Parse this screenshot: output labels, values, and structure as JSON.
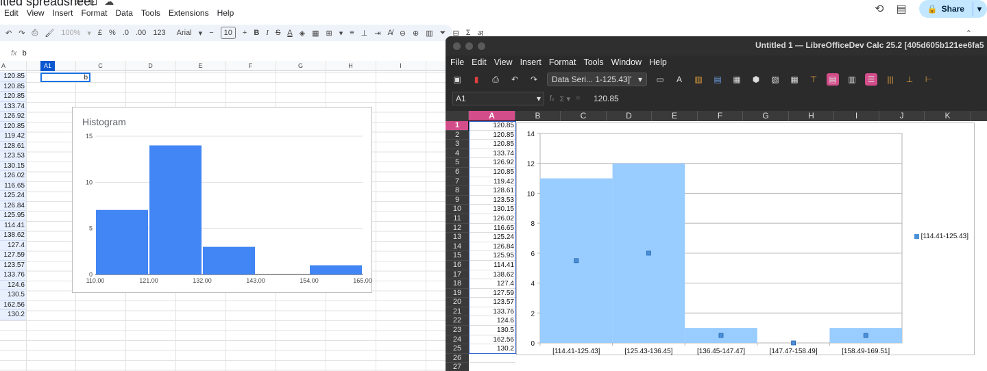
{
  "gsheets": {
    "title": "itled spreadsheet",
    "menu": [
      "Edit",
      "View",
      "Insert",
      "Format",
      "Data",
      "Tools",
      "Extensions",
      "Help"
    ],
    "share_label": "Share",
    "toolbar": {
      "zoom": "100%",
      "currency": "£",
      "percent": "%",
      "dec_less": ".0",
      "dec_more": ".00",
      "fmt123": "123",
      "font": "Arial",
      "font_size": "10"
    },
    "name_box": "A1",
    "formula_value": "b",
    "columns": [
      "A",
      "A1",
      "C",
      "D",
      "E",
      "F",
      "G",
      "H",
      "I"
    ],
    "col_a_values": [
      "120.85",
      "120.85",
      "120.85",
      "133.74",
      "126.92",
      "120.85",
      "119.42",
      "128.61",
      "123.53",
      "130.15",
      "126.02",
      "116.65",
      "125.24",
      "126.84",
      "125.95",
      "114.41",
      "138.62",
      "127.4",
      "127.59",
      "123.57",
      "133.76",
      "124.6",
      "130.5",
      "162.56",
      "130.2"
    ],
    "cell_b1": "b",
    "chart": {
      "title": "Histogram",
      "y_ticks": [
        "15",
        "10",
        "5",
        "0"
      ],
      "x_ticks": [
        "110.00",
        "121.00",
        "132.00",
        "143.00",
        "154.00",
        "165.00"
      ]
    }
  },
  "libreoffice": {
    "title": "Untitled 1 — LibreOfficeDev Calc 25.2 [405d605b121ee6fa5",
    "menu": [
      "File",
      "Edit",
      "View",
      "Insert",
      "Format",
      "Tools",
      "Window",
      "Help"
    ],
    "data_series_combo": "Data Seri... 1-125.43]'",
    "name_box": "A1",
    "formula_value": "120.85",
    "columns": [
      "A",
      "B",
      "C",
      "D",
      "E",
      "F",
      "G",
      "H",
      "I",
      "J",
      "K"
    ],
    "rows": [
      {
        "n": "1",
        "v": "120.85"
      },
      {
        "n": "2",
        "v": "120.85"
      },
      {
        "n": "3",
        "v": "120.85"
      },
      {
        "n": "4",
        "v": "133.74"
      },
      {
        "n": "5",
        "v": "126.92"
      },
      {
        "n": "6",
        "v": "120.85"
      },
      {
        "n": "7",
        "v": "119.42"
      },
      {
        "n": "8",
        "v": "128.61"
      },
      {
        "n": "9",
        "v": "123.53"
      },
      {
        "n": "10",
        "v": "130.15"
      },
      {
        "n": "11",
        "v": "126.02"
      },
      {
        "n": "12",
        "v": "116.65"
      },
      {
        "n": "13",
        "v": "125.24"
      },
      {
        "n": "14",
        "v": "126.84"
      },
      {
        "n": "15",
        "v": "125.95"
      },
      {
        "n": "16",
        "v": "114.41"
      },
      {
        "n": "17",
        "v": "138.62"
      },
      {
        "n": "18",
        "v": "127.4"
      },
      {
        "n": "19",
        "v": "127.59"
      },
      {
        "n": "20",
        "v": "123.57"
      },
      {
        "n": "21",
        "v": "133.76"
      },
      {
        "n": "22",
        "v": "124.6"
      },
      {
        "n": "23",
        "v": "130.5"
      },
      {
        "n": "24",
        "v": "162.56"
      },
      {
        "n": "25",
        "v": "130.2"
      },
      {
        "n": "26",
        "v": ""
      },
      {
        "n": "27",
        "v": ""
      }
    ],
    "legend": "[114.41-125.43]"
  },
  "chart_data": [
    {
      "type": "bar",
      "title": "Histogram",
      "bins": [
        [
          110,
          121
        ],
        [
          121,
          132
        ],
        [
          132,
          143
        ],
        [
          143,
          154
        ],
        [
          154,
          165
        ]
      ],
      "values": [
        7,
        14,
        3,
        0,
        1
      ],
      "x_ticks": [
        110,
        121,
        132,
        143,
        154,
        165
      ],
      "ylim": [
        0,
        15
      ],
      "y_ticks": [
        0,
        5,
        10,
        15
      ],
      "color": "#4285f4",
      "grid": true
    },
    {
      "type": "bar",
      "categories": [
        "[114.41-125.43]",
        "[125.43-136.45]",
        "[136.45-147.47]",
        "[147.47-158.49]",
        "[158.49-169.51]"
      ],
      "series": [
        {
          "name": "[114.41-125.43]",
          "values": [
            11,
            12,
            1,
            0,
            1
          ]
        }
      ],
      "ylim": [
        0,
        14
      ],
      "y_ticks": [
        0,
        2,
        4,
        6,
        8,
        10,
        12,
        14
      ],
      "color": "#99ccff",
      "grid": true,
      "legend": "right"
    }
  ]
}
